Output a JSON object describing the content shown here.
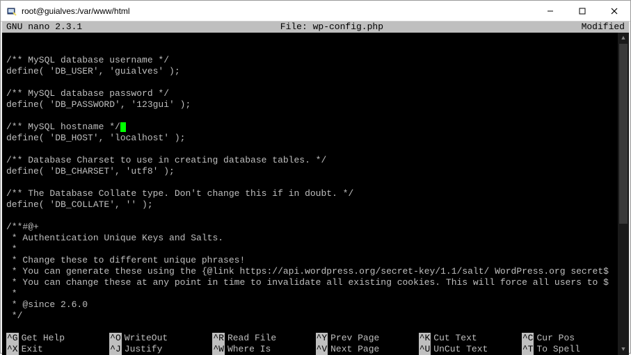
{
  "window": {
    "title": "root@guialves:/var/www/html"
  },
  "nano": {
    "version": "GNU nano 2.3.1",
    "file_label": "File: wp-config.php",
    "status": "Modified"
  },
  "file": {
    "lines": [
      "",
      "",
      "/** MySQL database username */",
      "define( 'DB_USER', 'guialves' );",
      "",
      "/** MySQL database password */",
      "define( 'DB_PASSWORD', '123gui' );",
      "",
      "/** MySQL hostname */",
      "define( 'DB_HOST', 'localhost' );",
      "",
      "/** Database Charset to use in creating database tables. */",
      "define( 'DB_CHARSET', 'utf8' );",
      "",
      "/** The Database Collate type. Don't change this if in doubt. */",
      "define( 'DB_COLLATE', '' );",
      "",
      "/**#@+",
      " * Authentication Unique Keys and Salts.",
      " *",
      " * Change these to different unique phrases!",
      " * You can generate these using the {@link https://api.wordpress.org/secret-key/1.1/salt/ WordPress.org secret$",
      " * You can change these at any point in time to invalidate all existing cookies. This will force all users to $",
      " *",
      " * @since 2.6.0",
      " */",
      ""
    ],
    "cursor_line": 8,
    "cursor_after": "/** MySQL hostname */"
  },
  "shortcuts": {
    "row1": [
      {
        "key": "^G",
        "label": "Get Help"
      },
      {
        "key": "^O",
        "label": "WriteOut"
      },
      {
        "key": "^R",
        "label": "Read File"
      },
      {
        "key": "^Y",
        "label": "Prev Page"
      },
      {
        "key": "^K",
        "label": "Cut Text"
      },
      {
        "key": "^C",
        "label": "Cur Pos"
      }
    ],
    "row2": [
      {
        "key": "^X",
        "label": "Exit"
      },
      {
        "key": "^J",
        "label": "Justify"
      },
      {
        "key": "^W",
        "label": "Where Is"
      },
      {
        "key": "^V",
        "label": "Next Page"
      },
      {
        "key": "^U",
        "label": "UnCut Text"
      },
      {
        "key": "^T",
        "label": "To Spell"
      }
    ]
  }
}
